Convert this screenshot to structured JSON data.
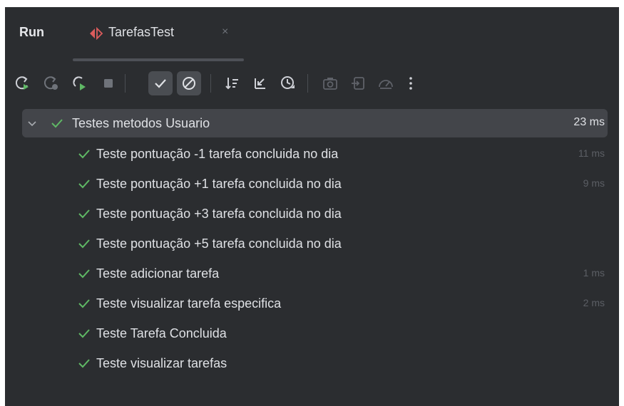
{
  "header": {
    "run_label": "Run",
    "tab": {
      "label": "TarefasTest",
      "close_glyph": "×",
      "icon": "test-run-icon"
    }
  },
  "toolbar": {
    "buttons": [
      {
        "name": "rerun-icon",
        "state": "enabled"
      },
      {
        "name": "rerun-failed-icon",
        "state": "disabled"
      },
      {
        "name": "rerun-auto-icon",
        "state": "enabled"
      },
      {
        "name": "stop-icon",
        "state": "disabled"
      },
      {
        "name": "show-passed-icon",
        "state": "toggled"
      },
      {
        "name": "show-ignored-icon",
        "state": "toggled"
      },
      {
        "name": "sort-alpha-icon",
        "state": "enabled"
      },
      {
        "name": "collapse-all-icon",
        "state": "enabled"
      },
      {
        "name": "sort-duration-icon",
        "state": "enabled"
      },
      {
        "name": "camera-icon",
        "state": "disabled"
      },
      {
        "name": "import-icon",
        "state": "disabled"
      },
      {
        "name": "coverage-icon",
        "state": "disabled"
      },
      {
        "name": "more-icon",
        "state": "enabled"
      }
    ]
  },
  "tree": {
    "root": {
      "label": "Testes metodos Usuario",
      "time": "23 ms",
      "status": "passed",
      "expanded": true
    },
    "items": [
      {
        "label": "Teste pontuação -1 tarefa concluida no dia",
        "time": "11 ms",
        "status": "passed"
      },
      {
        "label": "Teste pontuação +1 tarefa concluida no dia",
        "time": "9 ms",
        "status": "passed"
      },
      {
        "label": "Teste pontuação +3 tarefa concluida no dia",
        "time": "",
        "status": "passed"
      },
      {
        "label": "Teste pontuação +5 tarefa concluida no dia",
        "time": "",
        "status": "passed"
      },
      {
        "label": "Teste adicionar tarefa",
        "time": "1 ms",
        "status": "passed"
      },
      {
        "label": "Teste visualizar tarefa especifica",
        "time": "2 ms",
        "status": "passed"
      },
      {
        "label": "Teste Tarefa Concluida",
        "time": "",
        "status": "passed"
      },
      {
        "label": "Teste visualizar tarefas",
        "time": "",
        "status": "passed"
      }
    ]
  },
  "colors": {
    "panel_bg": "#2b2d30",
    "selection_bg": "#43454a",
    "pass_green": "#5fb865",
    "text": "#dfe1e5",
    "muted_time": "#5c5f65",
    "tab_icon_red": "#db5c5c"
  }
}
